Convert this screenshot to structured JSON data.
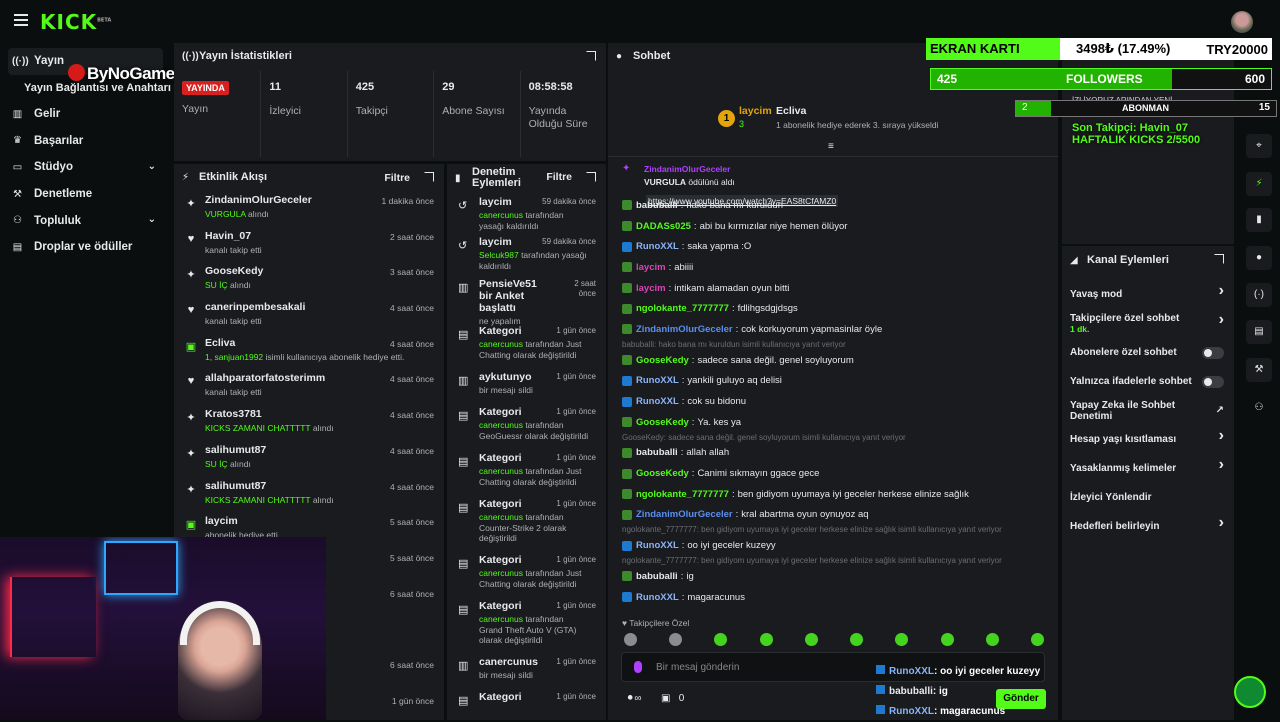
{
  "brand": {
    "logo": "KICK",
    "beta": "BETA"
  },
  "sidebar": {
    "items": [
      {
        "label": "Yayın",
        "icon": "broadcast-icon"
      },
      {
        "label": "Yayın Bağlantısı ve Anahtarı"
      },
      {
        "label": "Gelir",
        "icon": "chart-icon"
      },
      {
        "label": "Başarılar",
        "icon": "trophy-icon"
      },
      {
        "label": "Stüdyo",
        "icon": "monitor-icon"
      },
      {
        "label": "Denetleme",
        "icon": "wrench-icon"
      },
      {
        "label": "Topluluk",
        "icon": "community-icon"
      },
      {
        "label": "Droplar ve ödüller",
        "icon": "gift-icon"
      }
    ]
  },
  "watermark": "ByNoGame",
  "stats": {
    "title": "Yayın İstatistikleri",
    "live": "YAYINDA",
    "live_label": "Yayın",
    "viewers": "11",
    "viewers_label": "İzleyici",
    "followers": "425",
    "followers_label": "Takipçi",
    "subs": "29",
    "subs_label": "Abone Sayısı",
    "duration": "08:58:58",
    "duration_label": "Yayında Olduğu Süre"
  },
  "activity": {
    "title": "Etkinlik Akışı",
    "filter": "Filtre",
    "items": [
      {
        "name": "ZindanimOlurGeceler",
        "sub_g": "VURGULA",
        "sub": " alındı",
        "time": "1 dakika önce",
        "icon": "gift-icon"
      },
      {
        "name": "Havin_07",
        "sub_g": "",
        "sub": "kanalı takip etti",
        "time": "2 saat önce",
        "icon": "heart-icon"
      },
      {
        "name": "GooseKedy",
        "sub_g": "SU İÇ",
        "sub": " alındı",
        "time": "3 saat önce",
        "icon": "gift-icon"
      },
      {
        "name": "canerinpembesakali",
        "sub_g": "",
        "sub": "kanalı takip etti",
        "time": "4 saat önce",
        "icon": "heart-icon"
      },
      {
        "name": "Ecliva",
        "sub_g": "1, sanjuan1992",
        "sub": " isimli kullanıcıya abonelik hediye etti.",
        "time": "4 saat önce",
        "icon": "sub-gift-icon"
      },
      {
        "name": "allahparatorfatosterimm",
        "sub_g": "",
        "sub": "kanalı takip etti",
        "time": "4 saat önce",
        "icon": "heart-icon"
      },
      {
        "name": "Kratos3781",
        "sub_g": "KICKS ZAMANI CHATTTTT",
        "sub": " alındı",
        "time": "4 saat önce",
        "icon": "gift-icon"
      },
      {
        "name": "salihumut87",
        "sub_g": "SU İÇ",
        "sub": " alındı",
        "time": "4 saat önce",
        "icon": "gift-icon"
      },
      {
        "name": "salihumut87",
        "sub_g": "KICKS ZAMANI CHATTTTT",
        "sub": " alındı",
        "time": "4 saat önce",
        "icon": "gift-icon"
      },
      {
        "name": "laycim",
        "sub_g": "",
        "sub": "abonelik hediye etti.",
        "time": "5 saat önce",
        "icon": "sub-gift-icon"
      },
      {
        "name": "",
        "sub_g": "",
        "sub": "",
        "time": "5 saat önce",
        "icon": ""
      },
      {
        "name": "",
        "sub_g": "",
        "sub": "",
        "time": "6 saat önce",
        "icon": ""
      },
      {
        "name": "",
        "sub_g": "",
        "sub": "",
        "time": "",
        "icon": ""
      },
      {
        "name": "",
        "sub_g": "",
        "sub": "",
        "time": "6 saat önce",
        "icon": ""
      },
      {
        "name": "",
        "sub_g": "",
        "sub": "",
        "time": "1 gün önce",
        "icon": ""
      }
    ]
  },
  "mod": {
    "title": "Denetim Eylemleri",
    "filter": "Filtre",
    "items": [
      {
        "name": "laycim",
        "time": "59 dakika önce",
        "g": "canercunus",
        "sub": " tarafından yasağı kaldırıldı",
        "h": 40
      },
      {
        "name": "laycim",
        "time": "59 dakika önce",
        "g": "Selcuk987",
        "sub": " tarafından yasağı kaldırıldı",
        "h": 42
      },
      {
        "name": "PensieVe51 bir Anket başlattı",
        "time": "2 saat önce",
        "g": "",
        "sub": "ne yapalım",
        "h": 47
      },
      {
        "name": "Kategori",
        "time": "1 gün önce",
        "g": "canercunus",
        "sub": " tarafından Just Chatting olarak değiştirildi",
        "h": 46
      },
      {
        "name": "aykutunyo",
        "time": "1 gün önce",
        "g": "",
        "sub": "bir mesajı sildi",
        "h": 35
      },
      {
        "name": "Kategori",
        "time": "1 gün önce",
        "g": "canercunus",
        "sub": " tarafından GeoGuessr olarak değiştirildi",
        "h": 46
      },
      {
        "name": "Kategori",
        "time": "1 gün önce",
        "g": "canercunus",
        "sub": " tarafından Just Chatting olarak değiştirildi",
        "h": 46
      },
      {
        "name": "Kategori",
        "time": "1 gün önce",
        "g": "canercunus",
        "sub": " tarafından Counter-Strike 2 olarak değiştirildi",
        "h": 56
      },
      {
        "name": "Kategori",
        "time": "1 gün önce",
        "g": "canercunus",
        "sub": " tarafından Just Chatting olarak değiştirildi",
        "h": 46
      },
      {
        "name": "Kategori",
        "time": "1 gün önce",
        "g": "canercunus",
        "sub": " tarafından Grand Theft Auto V (GTA) olarak değiştirildi",
        "h": 56
      },
      {
        "name": "canercunus",
        "time": "1 gün önce",
        "g": "",
        "sub": "bir mesajı sildi",
        "h": 35
      },
      {
        "name": "Kategori",
        "time": "1 gün önce",
        "g": "",
        "sub": "",
        "h": 20
      }
    ]
  },
  "chat": {
    "title": "Sohbet",
    "pinned": {
      "rank": "1",
      "name": "laycim",
      "count": "3",
      "gifter": "Ecliva",
      "desc": "1 abonelik hediye ederek 3. sıraya yükseldi"
    },
    "top_reward": {
      "user": "ZindanimOlurGeceler",
      "reward": "VURGULA",
      "text": " ödülünü aldı",
      "link": "https://www.youtube.com/watch?v=EAS8tCfAMZ0"
    },
    "messages": [
      {
        "user": "babuballi",
        "color": "#e7e9ea",
        "badge": "green",
        "text": "hako bana mı kuruldun"
      },
      {
        "user": "DADASs025",
        "color": "#53fc18",
        "badge": "green",
        "text": "abi bu kırmızılar niye hemen ölüyor"
      },
      {
        "user": "RunoXXL",
        "color": "#8ab4f8",
        "badge": "blue",
        "text": "saka yapma :O"
      },
      {
        "user": "laycim",
        "color": "#d946b5",
        "badge": "green",
        "text": "abiiii"
      },
      {
        "user": "laycim",
        "color": "#d946b5",
        "badge": "green",
        "text": "intikam alamadan oyun bitti"
      },
      {
        "user": "ngolokante_7777777",
        "color": "#53fc18",
        "badge": "green",
        "text": "fdlihgsdgjdsgs"
      },
      {
        "user": "ZindanimOlurGeceler",
        "color": "#5a8ff0",
        "badge": "green",
        "text": "cok korkuyorum yapmasinlar öyle"
      },
      {
        "reply": "babuballi: hako bana mı kuruldun isimli kullanıcıya yanıt veriyor"
      },
      {
        "user": "GooseKedy",
        "color": "#53fc18",
        "badge": "green",
        "text": "sadece sana değil. genel soyluyorum"
      },
      {
        "user": "RunoXXL",
        "color": "#8ab4f8",
        "badge": "blue",
        "text": "yankili guluyo aq delisi"
      },
      {
        "user": "RunoXXL",
        "color": "#8ab4f8",
        "badge": "blue",
        "text": "cok su bidonu"
      },
      {
        "user": "GooseKedy",
        "color": "#53fc18",
        "badge": "green",
        "text": "Ya. kes ya"
      },
      {
        "reply": "GooseKedy: sadece sana değil. genel soyluyorum isimli kullanıcıya yanıt veriyor"
      },
      {
        "user": "babuballi",
        "color": "#e7e9ea",
        "badge": "green",
        "text": "allah allah"
      },
      {
        "user": "GooseKedy",
        "color": "#53fc18",
        "badge": "green",
        "text": "Canimi sıkmayın ggace gece"
      },
      {
        "user": "ngolokante_7777777",
        "color": "#53fc18",
        "badge": "green",
        "text": "ben gidiyom uyumaya iyi geceler herkese elinize sağlık"
      },
      {
        "user": "ZindanimOlurGeceler",
        "color": "#5a8ff0",
        "badge": "green",
        "text": "kral abartma oyun oynuyoz aq"
      },
      {
        "reply": "ngolokante_7777777: ben gidiyom uyumaya iyi geceler herkese elinize sağlık isimli kullanıcıya yanıt veriyor"
      },
      {
        "user": "RunoXXL",
        "color": "#8ab4f8",
        "badge": "blue",
        "text": "oo iyi geceler kuzeyy"
      },
      {
        "reply": "ngolokante_7777777: ben gidiyom uyumaya iyi geceler herkese elinize sağlık isimli kullanıcıya yanıt veriyor"
      },
      {
        "user": "babuballi",
        "color": "#e7e9ea",
        "badge": "green",
        "text": "ig"
      },
      {
        "user": "RunoXXL",
        "color": "#8ab4f8",
        "badge": "blue",
        "text": "magaracunus"
      }
    ],
    "follow_only": "Takipçilere Özel",
    "placeholder": "Bir mesaj gönderin",
    "send": "Gönder",
    "points": "0"
  },
  "channel": {
    "title": "Kanal Eylemleri",
    "items": [
      {
        "label": "Yavaş mod",
        "type": "chevron"
      },
      {
        "label": "Takipçilere özel sohbet",
        "sub": "1 dk.",
        "type": "chevron"
      },
      {
        "label": "Abonelere özel sohbet",
        "type": "toggle"
      },
      {
        "label": "Yalnızca ifadelerle sohbet",
        "type": "toggle"
      },
      {
        "label": "Yapay Zeka ile Sohbet Denetimi",
        "type": "ext"
      },
      {
        "label": "Hesap yaşı kısıtlaması",
        "type": "chevron"
      },
      {
        "label": "Yasaklanmış kelimeler",
        "type": "chevron"
      },
      {
        "label": "İzleyici Yönlendir",
        "type": "none"
      },
      {
        "label": "Hedefleri belirleyin",
        "type": "chevron"
      }
    ]
  },
  "overlay": {
    "gpu_label": "EKRAN KARTI",
    "gpu_value": "3498₺ (17.49%)",
    "gpu_target": "TRY20000",
    "gpu_progress": 0.1749,
    "followers_count": "425",
    "followers_label": "FOLLOWERS",
    "followers_target": "600",
    "followers_progress": 0.708,
    "sub_count": "2",
    "sub_label": "ABONMAN",
    "sub_target": "15",
    "sub_progress": 0.133,
    "ticker": "İZLİYORUZ ARINDAN YENİ...",
    "last_follower": "Son Takipçi: Havin_07",
    "weekly_kicks": "HAFTALIK KICKS 2/5500",
    "last_chat": [
      {
        "user": "RunoXXL",
        "text": ": oo iyi geceler kuzeyy"
      },
      {
        "user": "babuballi",
        "text": ": ig"
      },
      {
        "user": "RunoXXL",
        "text": ": magaracunus"
      }
    ]
  },
  "colors": {
    "brand": "#53fc18",
    "panel": "#191b1f",
    "bg": "#0b0e0f"
  }
}
